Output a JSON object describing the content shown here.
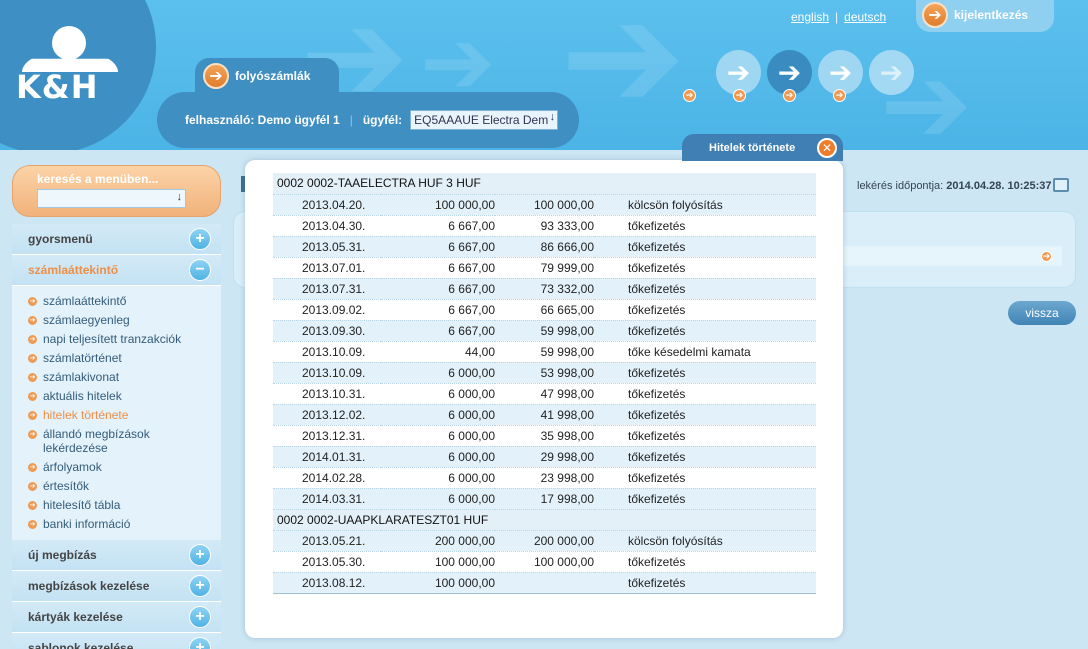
{
  "header": {
    "logo_text": "K&H",
    "lang_english": "english",
    "lang_separator": "|",
    "lang_german": "deutsch",
    "logout_label": "kijelentkezés",
    "account_tab_label": "folyószámlák",
    "user_label": "felhasználó: Demo ügyfél 1",
    "client_label": "ügyfél:",
    "client_value": "EQ5AAAUE Electra Dem"
  },
  "sidebar": {
    "search_label": "keresés a menüben...",
    "sections_top": [
      {
        "label": "gyorsmenü",
        "open": false
      },
      {
        "label": "számlaáttekintő",
        "open": true
      }
    ],
    "items": [
      {
        "label": "számlaáttekintő",
        "active": false
      },
      {
        "label": "számlaegyenleg",
        "active": false
      },
      {
        "label": "napi teljesített tranzakciók",
        "active": false
      },
      {
        "label": "számlatörténet",
        "active": false
      },
      {
        "label": "számlakivonat",
        "active": false
      },
      {
        "label": "aktuális hitelek",
        "active": false
      },
      {
        "label": "hitelek története",
        "active": true
      },
      {
        "label": "állandó megbízások lekérdezése",
        "active": false
      },
      {
        "label": "árfolyamok",
        "active": false
      },
      {
        "label": "értesítők",
        "active": false
      },
      {
        "label": "hitelesítő tábla",
        "active": false
      },
      {
        "label": "banki információ",
        "active": false
      }
    ],
    "sections_bottom": [
      {
        "label": "új megbízás"
      },
      {
        "label": "megbízások kezelése"
      },
      {
        "label": "kártyák kezelése"
      },
      {
        "label": "sablonok kezelése"
      }
    ]
  },
  "main": {
    "query_time_label": "lekérés időpontja:",
    "query_time_value": "2014.04.28. 10:25:37",
    "back_button": "vissza"
  },
  "modal": {
    "title": "Hitelek története",
    "close_symbol": "✕",
    "groups": [
      {
        "name": "0002 0002-TAAELECTRA HUF 3 HUF",
        "rows": [
          {
            "date": "2013.04.20.",
            "amount": "100 000,00",
            "balance": "100 000,00",
            "desc": "kölcsön folyósítás"
          },
          {
            "date": "2013.04.30.",
            "amount": "6 667,00",
            "balance": "93 333,00",
            "desc": "tőkefizetés"
          },
          {
            "date": "2013.05.31.",
            "amount": "6 667,00",
            "balance": "86 666,00",
            "desc": "tőkefizetés"
          },
          {
            "date": "2013.07.01.",
            "amount": "6 667,00",
            "balance": "79 999,00",
            "desc": "tőkefizetés"
          },
          {
            "date": "2013.07.31.",
            "amount": "6 667,00",
            "balance": "73 332,00",
            "desc": "tőkefizetés"
          },
          {
            "date": "2013.09.02.",
            "amount": "6 667,00",
            "balance": "66 665,00",
            "desc": "tőkefizetés"
          },
          {
            "date": "2013.09.30.",
            "amount": "6 667,00",
            "balance": "59 998,00",
            "desc": "tőkefizetés"
          },
          {
            "date": "2013.10.09.",
            "amount": "44,00",
            "balance": "59 998,00",
            "desc": "tőke késedelmi kamata"
          },
          {
            "date": "2013.10.09.",
            "amount": "6 000,00",
            "balance": "53 998,00",
            "desc": "tőkefizetés"
          },
          {
            "date": "2013.10.31.",
            "amount": "6 000,00",
            "balance": "47 998,00",
            "desc": "tőkefizetés"
          },
          {
            "date": "2013.12.02.",
            "amount": "6 000,00",
            "balance": "41 998,00",
            "desc": "tőkefizetés"
          },
          {
            "date": "2013.12.31.",
            "amount": "6 000,00",
            "balance": "35 998,00",
            "desc": "tőkefizetés"
          },
          {
            "date": "2014.01.31.",
            "amount": "6 000,00",
            "balance": "29 998,00",
            "desc": "tőkefizetés"
          },
          {
            "date": "2014.02.28.",
            "amount": "6 000,00",
            "balance": "23 998,00",
            "desc": "tőkefizetés"
          },
          {
            "date": "2014.03.31.",
            "amount": "6 000,00",
            "balance": "17 998,00",
            "desc": "tőkefizetés"
          }
        ]
      },
      {
        "name": "0002 0002-UAAPKLARATESZT01 HUF",
        "rows": [
          {
            "date": "2013.05.21.",
            "amount": "200 000,00",
            "balance": "200 000,00",
            "desc": "kölcsön folyósítás"
          },
          {
            "date": "2013.05.30.",
            "amount": "100 000,00",
            "balance": "100 000,00",
            "desc": "tőkefizetés"
          },
          {
            "date": "2013.08.12.",
            "amount": "100 000,00",
            "balance": "",
            "desc": "tőkefizetés"
          }
        ]
      }
    ]
  },
  "colors": {
    "header_blue": "#4bb4e6",
    "dark_blue": "#3f8fc3",
    "accent_orange": "#ee9a52",
    "active_menu": "#ef8e45",
    "row_alt": "#e2f1fa"
  }
}
